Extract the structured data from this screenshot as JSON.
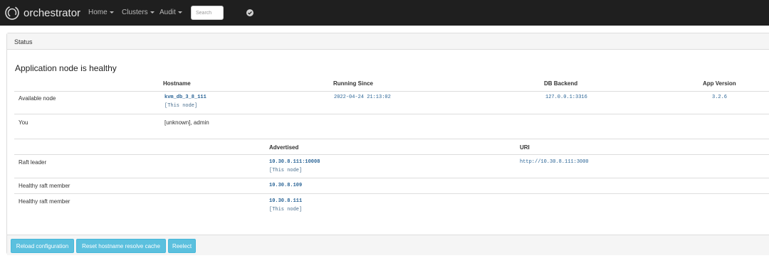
{
  "navbar": {
    "brand": "orchestrator",
    "menu": [
      {
        "label": "Home"
      },
      {
        "label": "Clusters"
      },
      {
        "label": "Audit"
      }
    ],
    "search_placeholder": "Search",
    "status_icon": "check-circle-icon"
  },
  "panel": {
    "heading": "Status",
    "health_title": "Application node is healthy",
    "nodes_table": {
      "columns": [
        "Hostname",
        "Running Since",
        "DB Backend",
        "App Version"
      ],
      "rows": [
        {
          "label": "Available node",
          "hostname": "kvm_db_3_8_111",
          "this_node": "[This node]",
          "running_since": "2022-04-24 21:13:02",
          "db_backend": "127.0.0.1:3316",
          "app_version": "3.2.6"
        },
        {
          "label": "You",
          "hostname": "[unknown], admin"
        }
      ]
    },
    "raft_table": {
      "columns": [
        "Advertised",
        "URI"
      ],
      "rows": [
        {
          "label": "Raft leader",
          "advertised": "10.30.8.111:10008",
          "this_node": "[This node]",
          "uri": "http://10.30.8.111:3000"
        },
        {
          "label": "Healthy raft member",
          "advertised": "10.30.8.109"
        },
        {
          "label": "Healthy raft member",
          "advertised": "10.30.8.111",
          "this_node": "[This node]"
        }
      ]
    },
    "buttons": {
      "reload": "Reload configuration",
      "reset": "Reset hostname resolve cache",
      "reelect": "Reelect"
    }
  },
  "colors": {
    "navbar_bg": "#1f1f1f",
    "button_info": "#5bc0de",
    "link": "#2a6496"
  }
}
